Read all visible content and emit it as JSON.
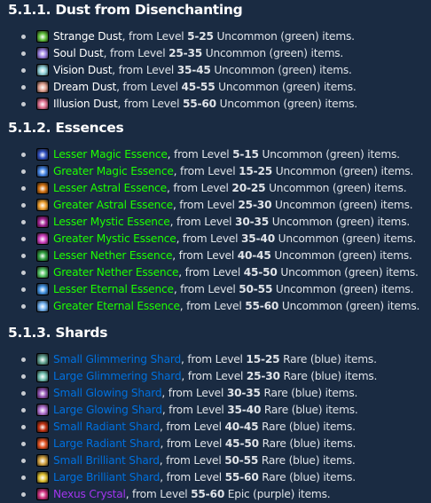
{
  "sections": [
    {
      "heading": "5.1.1. Dust from Disenchanting",
      "items": [
        {
          "name": "Strange Dust",
          "quality": "plain",
          "icon": "strange-dust-icon",
          "icon_color": "#5fbf3a",
          "prefix": ", from Level ",
          "level": "5-25",
          "suffix": " Uncommon (green) items."
        },
        {
          "name": "Soul Dust",
          "quality": "plain",
          "icon": "soul-dust-icon",
          "icon_color": "#9a7fe0",
          "prefix": ", from Level ",
          "level": "25-35",
          "suffix": " Uncommon (green) items."
        },
        {
          "name": "Vision Dust",
          "quality": "plain",
          "icon": "vision-dust-icon",
          "icon_color": "#8fd0d8",
          "prefix": ", from Level ",
          "level": "35-45",
          "suffix": " Uncommon (green) items."
        },
        {
          "name": "Dream Dust",
          "quality": "plain",
          "icon": "dream-dust-icon",
          "icon_color": "#e0a090",
          "prefix": ", from Level ",
          "level": "45-55",
          "suffix": " Uncommon (green) items."
        },
        {
          "name": "Illusion Dust",
          "quality": "plain",
          "icon": "illusion-dust-icon",
          "icon_color": "#e07090",
          "prefix": ", from Level ",
          "level": "55-60",
          "suffix": " Uncommon (green) items."
        }
      ]
    },
    {
      "heading": "5.1.2. Essences",
      "items": [
        {
          "name": "Lesser Magic Essence",
          "quality": "green",
          "icon": "lesser-magic-essence-icon",
          "icon_color": "#3050c0",
          "prefix": ", from Level ",
          "level": "5-15",
          "suffix": " Uncommon (green) items."
        },
        {
          "name": "Greater Magic Essence",
          "quality": "green",
          "icon": "greater-magic-essence-icon",
          "icon_color": "#4080e0",
          "prefix": ", from Level ",
          "level": "15-25",
          "suffix": " Uncommon (green) items."
        },
        {
          "name": "Lesser Astral Essence",
          "quality": "green",
          "icon": "lesser-astral-essence-icon",
          "icon_color": "#d07010",
          "prefix": ", from Level ",
          "level": "20-25",
          "suffix": " Uncommon (green) items."
        },
        {
          "name": "Greater Astral Essence",
          "quality": "green",
          "icon": "greater-astral-essence-icon",
          "icon_color": "#f0a030",
          "prefix": ", from Level ",
          "level": "25-30",
          "suffix": " Uncommon (green) items."
        },
        {
          "name": "Lesser Mystic Essence",
          "quality": "green",
          "icon": "lesser-mystic-essence-icon",
          "icon_color": "#a02090",
          "prefix": ", from Level ",
          "level": "30-35",
          "suffix": " Uncommon (green) items."
        },
        {
          "name": "Greater Mystic Essence",
          "quality": "green",
          "icon": "greater-mystic-essence-icon",
          "icon_color": "#d040c0",
          "prefix": ", from Level ",
          "level": "35-40",
          "suffix": " Uncommon (green) items."
        },
        {
          "name": "Lesser Nether Essence",
          "quality": "green",
          "icon": "lesser-nether-essence-icon",
          "icon_color": "#30a040",
          "prefix": ", from Level ",
          "level": "40-45",
          "suffix": " Uncommon (green) items."
        },
        {
          "name": "Greater Nether Essence",
          "quality": "green",
          "icon": "greater-nether-essence-icon",
          "icon_color": "#50c060",
          "prefix": ", from Level ",
          "level": "45-50",
          "suffix": " Uncommon (green) items."
        },
        {
          "name": "Lesser Eternal Essence",
          "quality": "green",
          "icon": "lesser-eternal-essence-icon",
          "icon_color": "#4090e0",
          "prefix": ", from Level ",
          "level": "50-55",
          "suffix": " Uncommon (green) items."
        },
        {
          "name": "Greater Eternal Essence",
          "quality": "green",
          "icon": "greater-eternal-essence-icon",
          "icon_color": "#70b0f0",
          "prefix": ", from Level ",
          "level": "55-60",
          "suffix": " Uncommon (green) items."
        }
      ]
    },
    {
      "heading": "5.1.3. Shards",
      "items": [
        {
          "name": "Small Glimmering Shard",
          "quality": "blue",
          "icon": "small-glimmering-shard-icon",
          "icon_color": "#60a090",
          "prefix": ", from Level ",
          "level": "15-25",
          "suffix": " Rare (blue) items."
        },
        {
          "name": "Large Glimmering Shard",
          "quality": "blue",
          "icon": "large-glimmering-shard-icon",
          "icon_color": "#70c0b0",
          "prefix": ", from Level ",
          "level": "25-30",
          "suffix": " Rare (blue) items."
        },
        {
          "name": "Small Glowing Shard",
          "quality": "blue",
          "icon": "small-glowing-shard-icon",
          "icon_color": "#9050b0",
          "prefix": ", from Level ",
          "level": "30-35",
          "suffix": " Rare (blue) items."
        },
        {
          "name": "Large Glowing Shard",
          "quality": "blue",
          "icon": "large-glowing-shard-icon",
          "icon_color": "#b070d0",
          "prefix": ", from Level ",
          "level": "35-40",
          "suffix": " Rare (blue) items."
        },
        {
          "name": "Small Radiant Shard",
          "quality": "blue",
          "icon": "small-radiant-shard-icon",
          "icon_color": "#c03010",
          "prefix": ", from Level ",
          "level": "40-45",
          "suffix": " Rare (blue) items."
        },
        {
          "name": "Large Radiant Shard",
          "quality": "blue",
          "icon": "large-radiant-shard-icon",
          "icon_color": "#e05020",
          "prefix": ", from Level ",
          "level": "45-50",
          "suffix": " Rare (blue) items."
        },
        {
          "name": "Small Brilliant Shard",
          "quality": "blue",
          "icon": "small-brilliant-shard-icon",
          "icon_color": "#d0a040",
          "prefix": ", from Level ",
          "level": "50-55",
          "suffix": " Rare (blue) items."
        },
        {
          "name": "Large Brilliant Shard",
          "quality": "blue",
          "icon": "large-brilliant-shard-icon",
          "icon_color": "#e0c030",
          "prefix": ", from Level ",
          "level": "55-60",
          "suffix": " Rare (blue) items."
        },
        {
          "name": "Nexus Crystal",
          "quality": "purple",
          "icon": "nexus-crystal-icon",
          "icon_color": "#d03080",
          "prefix": ", from Level ",
          "level": "55-60",
          "suffix": " Epic (purple) items."
        }
      ]
    }
  ]
}
